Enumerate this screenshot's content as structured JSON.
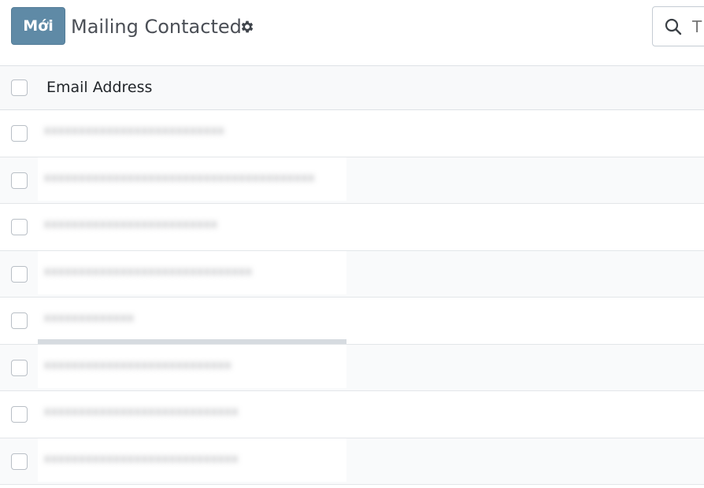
{
  "toolbar": {
    "new_button": "Mới",
    "title": "Mailing Contacted",
    "gear_icon": "gear-icon",
    "search_icon": "search-icon",
    "search_placeholder": "T"
  },
  "table": {
    "column_header": "Email Address",
    "rows": [
      {
        "email": "xxxxxxxxxxxxxxxxxxxxxxxxxx"
      },
      {
        "email": "xxxxxxxxxxxxxxxxxxxxxxxxxxxxxxxxxxxxxxx"
      },
      {
        "email": "xxxxxxxxxxxxxxxxxxxxxxxxx"
      },
      {
        "email": "xxxxxxxxxxxxxxxxxxxxxxxxxxxxxx"
      },
      {
        "email": "xxxxxxxxxxxxx"
      },
      {
        "email": "xxxxxxxxxxxxxxxxxxxxxxxxxxx"
      },
      {
        "email": "xxxxxxxxxxxxxxxxxxxxxxxxxxxx"
      },
      {
        "email": "xxxxxxxxxxxxxxxxxxxxxxxxxxxx"
      }
    ]
  },
  "colors": {
    "new_button_bg": "#5f8aa6",
    "header_bg": "#f8f9fa",
    "row_border": "#e3e6e9"
  }
}
